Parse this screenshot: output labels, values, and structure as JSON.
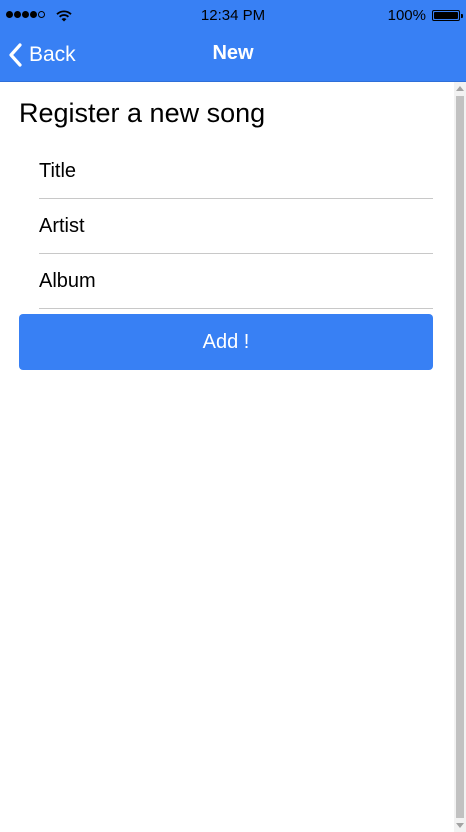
{
  "status_bar": {
    "time": "12:34 PM",
    "battery_percent": "100%",
    "signal_bars_filled": 4,
    "signal_bars_total": 5,
    "icons": [
      "signal-icon",
      "wifi-icon",
      "battery-icon"
    ]
  },
  "nav_bar": {
    "back_label": "Back",
    "title": "New",
    "back_icon": "chevron-left-icon"
  },
  "page": {
    "title": "Register a new song"
  },
  "form": {
    "fields": [
      {
        "placeholder": "Title",
        "value": ""
      },
      {
        "placeholder": "Artist",
        "value": ""
      },
      {
        "placeholder": "Album",
        "value": ""
      }
    ],
    "submit_label": "Add !"
  },
  "colors": {
    "accent": "#3880f4",
    "divider": "#c8c8c8",
    "text": "#000000"
  }
}
